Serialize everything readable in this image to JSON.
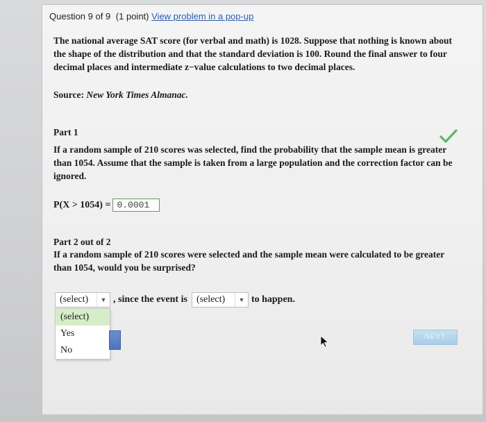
{
  "header": {
    "counter": "Question 9 of 9",
    "points": "(1 point)",
    "popup_link": "View problem in a pop-up"
  },
  "intro": {
    "text": "The national average SAT score (for verbal and math) is 1028. Suppose that nothing is known about the shape of the distribution and that the standard deviation is 100. Round the final answer to four decimal places and intermediate z−value calculations to two decimal places."
  },
  "source": {
    "label": "Source:",
    "title": "New York Times Almanac."
  },
  "part1": {
    "title": "Part 1",
    "question": "If a random sample of 210 scores was selected, find the probability that the sample mean is greater than 1054. Assume that the sample is taken from a large population and the correction factor can be ignored.",
    "formula_label": "P(X > 1054) =",
    "answer": "0.0001",
    "status_icon": "check-icon",
    "status_color": "#5cb85c"
  },
  "part2": {
    "title": "Part 2 out of 2",
    "question": "If a random sample of 210 scores were selected and the sample mean were calculated to be greater than 1054, would you be surprised?",
    "select1_value": "(select)",
    "connector_text": ", since the event is",
    "select2_value": "(select)",
    "ending_text": "to happen.",
    "dropdown_options": [
      "(select)",
      "Yes",
      "No"
    ]
  },
  "footer": {
    "next_label": "NEXT"
  }
}
